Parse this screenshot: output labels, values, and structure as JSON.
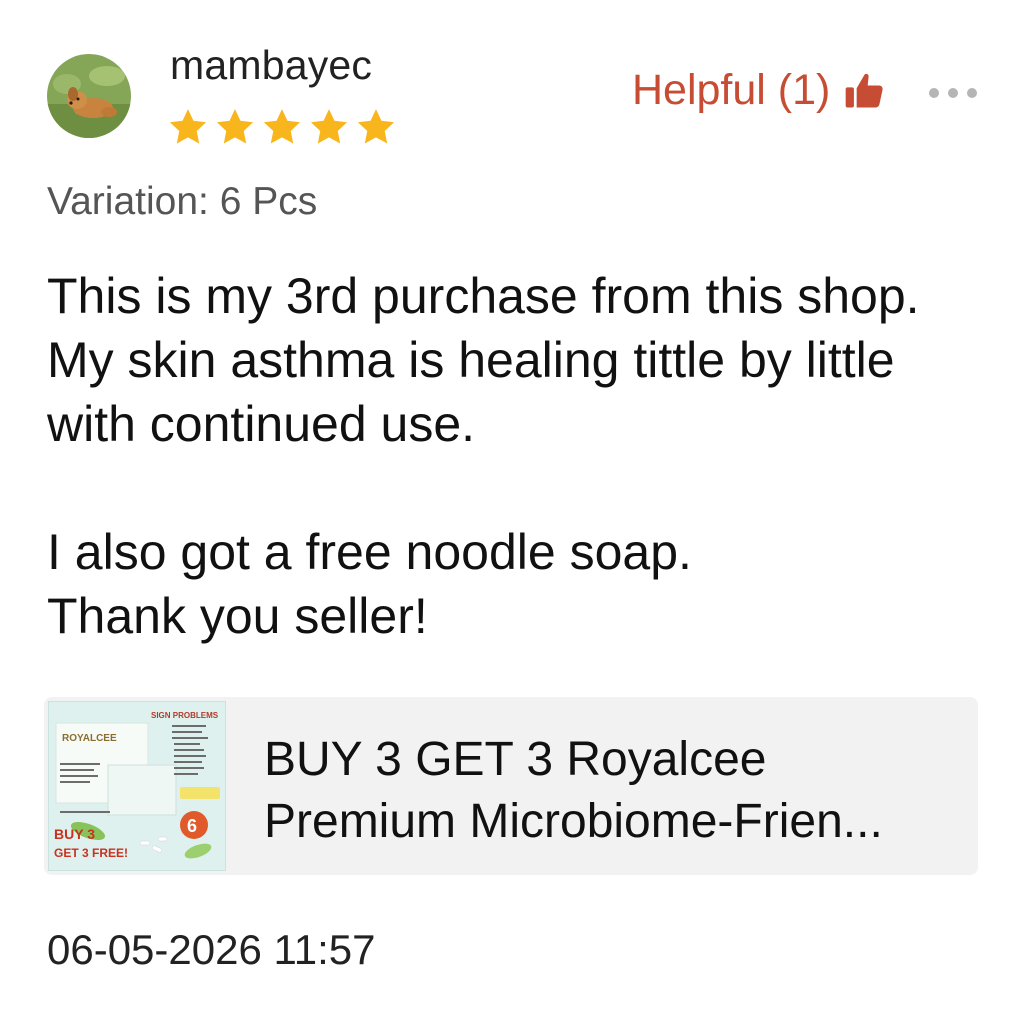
{
  "review": {
    "username": "mambayec",
    "rating": 5,
    "rating_max": 5,
    "helpful_label": "Helpful (1)",
    "variation": "Variation: 6 Pcs",
    "text": "This is my 3rd purchase from this shop.\nMy skin asthma is healing tittle by little\nwith continued  use.\n\nI also got a free noodle soap.\nThank you seller!",
    "timestamp": "06-05-2026 11:57"
  },
  "product": {
    "title_line1": "BUY 3 GET 3 Royalcee",
    "title_line2": "Premium Microbiome-Frien...",
    "thumbnail": {
      "brand": "ROYALCEE",
      "heading": "SIGN PROBLEMS",
      "promo_line1": "BUY 3",
      "promo_line2": "GET 3 FREE!",
      "count_badge": "6"
    }
  },
  "icons": {
    "avatar": "dog-avatar",
    "star": "star-icon",
    "thumb": "thumbs-up-icon",
    "more": "more-options-icon"
  },
  "colors": {
    "star": "#f8b61c",
    "helpful": "#c64c33",
    "card_background": "#f2f2f2"
  }
}
